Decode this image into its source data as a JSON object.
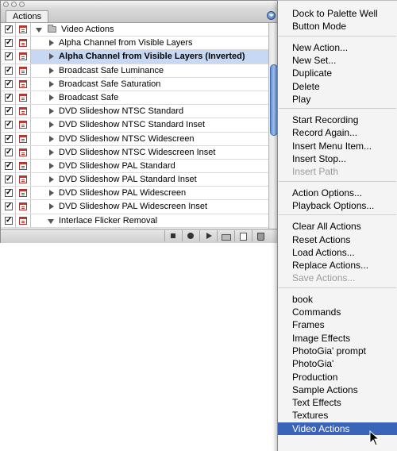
{
  "palette": {
    "tab_label": "Actions",
    "set_row": {
      "label": "Video Actions"
    },
    "actions": [
      {
        "label": "Alpha Channel from Visible Layers",
        "selected": false,
        "dialog": true
      },
      {
        "label": "Alpha Channel from Visible Layers (Inverted)",
        "selected": true,
        "dialog": true
      },
      {
        "label": "Broadcast Safe Luminance",
        "selected": false,
        "dialog": true
      },
      {
        "label": "Broadcast Safe Saturation",
        "selected": false,
        "dialog": true
      },
      {
        "label": "Broadcast Safe",
        "selected": false,
        "dialog": true
      },
      {
        "label": "DVD Slideshow NTSC Standard",
        "selected": false,
        "dialog": true
      },
      {
        "label": "DVD Slideshow NTSC Standard Inset",
        "selected": false,
        "dialog": true
      },
      {
        "label": "DVD Slideshow NTSC Widescreen",
        "selected": false,
        "dialog": true
      },
      {
        "label": "DVD Slideshow NTSC Widescreen Inset",
        "selected": false,
        "dialog": true
      },
      {
        "label": "DVD Slideshow PAL Standard",
        "selected": false,
        "dialog": true
      },
      {
        "label": "DVD Slideshow PAL Standard Inset",
        "selected": false,
        "dialog": true
      },
      {
        "label": "DVD Slideshow PAL Widescreen",
        "selected": false,
        "dialog": true
      },
      {
        "label": "DVD Slideshow PAL Widescreen Inset",
        "selected": false,
        "dialog": true
      },
      {
        "label": "Interlace Flicker Removal",
        "selected": false,
        "dialog": true,
        "expanded": true
      }
    ]
  },
  "menu": {
    "groups": [
      [
        {
          "label": "Dock to Palette Well"
        },
        {
          "label": "Button Mode"
        }
      ],
      [
        {
          "label": "New Action..."
        },
        {
          "label": "New Set..."
        },
        {
          "label": "Duplicate"
        },
        {
          "label": "Delete"
        },
        {
          "label": "Play"
        }
      ],
      [
        {
          "label": "Start Recording"
        },
        {
          "label": "Record Again..."
        },
        {
          "label": "Insert Menu Item..."
        },
        {
          "label": "Insert Stop..."
        },
        {
          "label": "Insert Path",
          "disabled": true
        }
      ],
      [
        {
          "label": "Action Options..."
        },
        {
          "label": "Playback Options..."
        }
      ],
      [
        {
          "label": "Clear All Actions"
        },
        {
          "label": "Reset Actions"
        },
        {
          "label": "Load Actions..."
        },
        {
          "label": "Replace Actions..."
        },
        {
          "label": "Save Actions...",
          "disabled": true
        }
      ],
      [
        {
          "label": "book"
        },
        {
          "label": "Commands"
        },
        {
          "label": "Frames"
        },
        {
          "label": "Image Effects"
        },
        {
          "label": "PhotoGia' prompt"
        },
        {
          "label": "PhotoGia'"
        },
        {
          "label": "Production"
        },
        {
          "label": "Sample Actions"
        },
        {
          "label": "Text Effects"
        },
        {
          "label": "Textures"
        },
        {
          "label": "Video Actions",
          "highlighted": true
        }
      ]
    ]
  },
  "colors": {
    "selection_row": "#c7d8f4",
    "menu_highlight": "#3a64b7",
    "dialog_icon": "#c0392b"
  }
}
